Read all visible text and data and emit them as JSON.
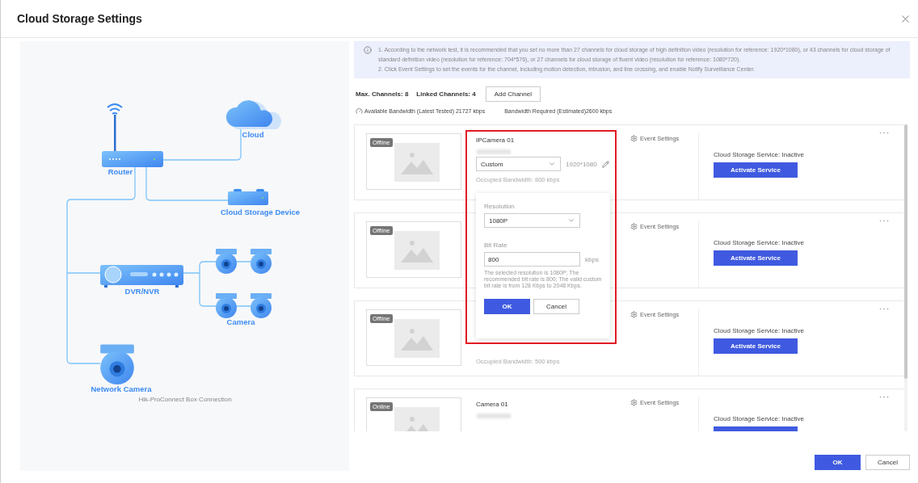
{
  "dialog": {
    "title": "Cloud Storage Settings"
  },
  "diagram": {
    "nodes": [
      {
        "kind": "router",
        "label": "Router"
      },
      {
        "kind": "cloud",
        "label": "Cloud"
      },
      {
        "kind": "storage",
        "label": "Cloud Storage Device"
      },
      {
        "kind": "dvr",
        "label": "DVR/NVR"
      },
      {
        "kind": "cameras",
        "label": "Camera"
      },
      {
        "kind": "network_camera",
        "label": "Network Camera"
      }
    ],
    "caption": "Hik-ProConnect Box Connection"
  },
  "notice": {
    "lines": [
      "1. According to the network test, it is recommended that you set no more than 27 channels for cloud storage of high definition video (resolution for reference: 1920*1080), or 43 channels for cloud storage of standard definition video (resolution for reference: 704*576), or 27 channels for cloud storage of fluent video (resolution for reference: 1080*720).",
      "2. Click Event Settings to set the events for the channel, including motion detection, intrusion, and line crossing, and enable Notify Surveillance Center."
    ]
  },
  "stats": {
    "max_channels": "Max. Channels: 8",
    "linked_channels": "Linked Channels: 4",
    "add_button": "Add Channel",
    "available_bandwidth": "Available Bandwidth (Latest Tested) 21727 kbps",
    "required_bandwidth": "Bandwidth Required (Estimated)2600 kbps"
  },
  "channels": [
    {
      "status": "Offline",
      "name": "IPCamera 01",
      "stream": "Custom",
      "resolution": "1920*1080",
      "occupied": "Occupied Bandwidth: 800 kbps",
      "event_settings": "Event Settings",
      "service_status": "Cloud Storage Service: Inactive",
      "activate_button": "Activate Service",
      "highlighted": true
    },
    {
      "status": "Offline",
      "event_settings": "Event Settings",
      "service_status": "Cloud Storage Service: Inactive",
      "activate_button": "Activate Service",
      "highlighted": false
    },
    {
      "status": "Offline",
      "occupied": "Occupied Bandwidth: 500 kbps",
      "event_settings": "Event Settings",
      "service_status": "Cloud Storage Service: Inactive",
      "activate_button": "Activate Service",
      "highlighted": false
    },
    {
      "status": "Online",
      "name": "Camera 01",
      "event_settings": "Event Settings",
      "service_status": "Cloud Storage Service: Inactive",
      "highlighted": false
    }
  ],
  "popover": {
    "resolution_label": "Resolution",
    "resolution": "1080P",
    "bitrate_label": "Bit Rate",
    "bitrate": "800",
    "unit": "kbps",
    "help": "The selected resolution is 1080P; The recommended bit rate is 800; The valid custom bit rate is from 128 Kbps to 2048 Kbps.",
    "ok": "OK",
    "cancel": "Cancel"
  },
  "footer": {
    "ok": "OK",
    "cancel": "Cancel"
  }
}
